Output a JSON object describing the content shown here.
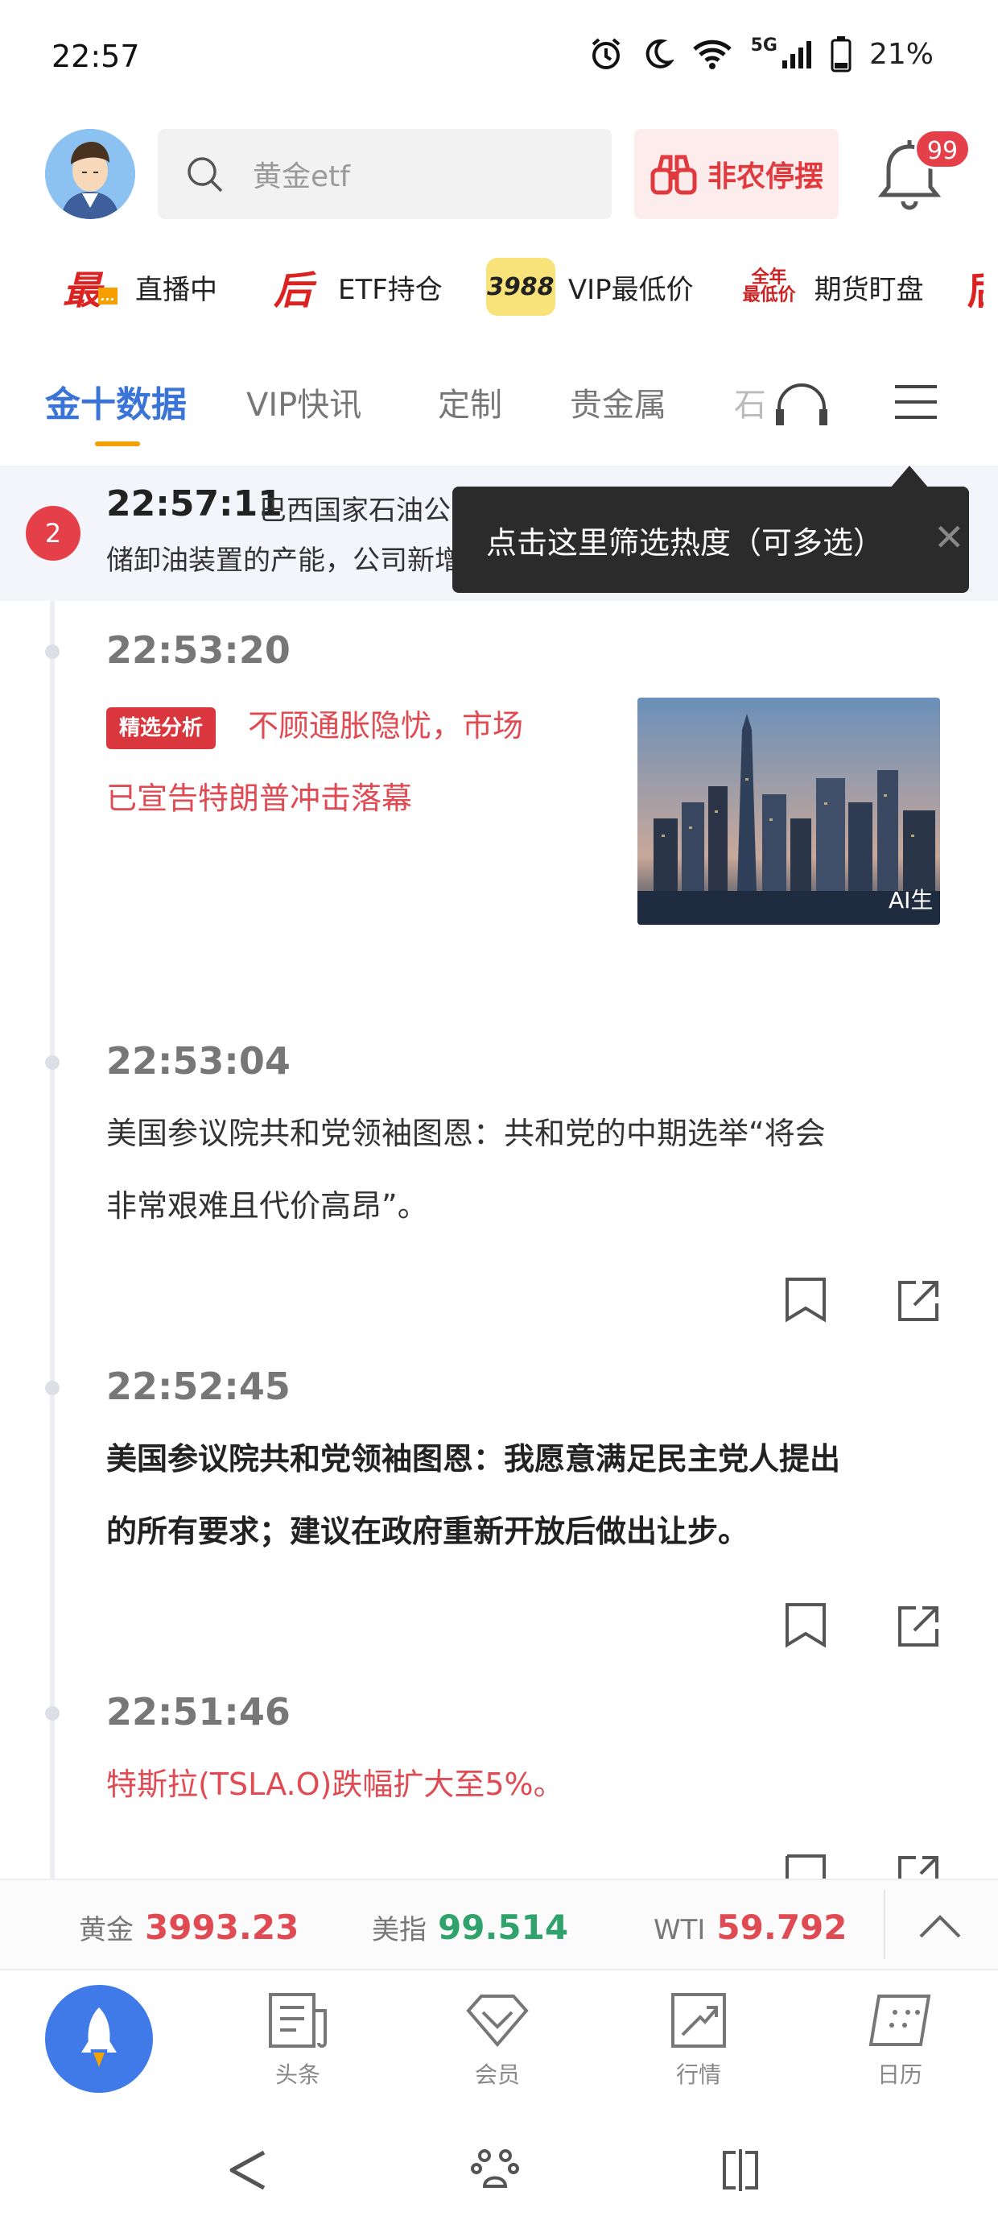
{
  "status_bar": {
    "time": "22:57",
    "network": "5G",
    "battery": "21%"
  },
  "header": {
    "search_placeholder": "黄金etf",
    "promo_label": "非农停摆",
    "notification_count": "99"
  },
  "quick_links": [
    {
      "label": "直播中",
      "icon": "live-icon"
    },
    {
      "label": "ETF持仓",
      "icon": "etf-icon"
    },
    {
      "label": "VIP最低价",
      "icon": "vip-price-icon",
      "badge": "3988"
    },
    {
      "label": "期货盯盘",
      "icon": "futures-icon"
    }
  ],
  "tabs": [
    {
      "label": "金十数据",
      "active": true
    },
    {
      "label": "VIP快讯"
    },
    {
      "label": "定制"
    },
    {
      "label": "贵金属"
    },
    {
      "label": "石"
    }
  ],
  "pinned": {
    "count": "2",
    "time": "22:57:11",
    "line1": "巴西国家石油公司首席财务官：通过提升浮式生产",
    "line2": "储卸油装置的产能，公司新增了11.5万桶/日的产量。"
  },
  "tooltip": {
    "text": "点击这里筛选热度（可多选）"
  },
  "news": [
    {
      "time": "22:53:20",
      "tag": "精选分析",
      "line1": "不顾通胀隐忧，市场",
      "line2": "已宣告特朗普冲击落幕",
      "image_label": "AI生"
    },
    {
      "time": "22:53:04",
      "line1": "美国参议院共和党领袖图恩：共和党的中期选举“将会",
      "line2": "非常艰难且代价高昂”。"
    },
    {
      "time": "22:52:45",
      "line1": "美国参议院共和党领袖图恩：我愿意满足民主党人提出",
      "line2": "的所有要求；建议在政府重新开放后做出让步。"
    },
    {
      "time": "22:51:46",
      "line1": "特斯拉(TSLA.O)跌幅扩大至5%。"
    }
  ],
  "ticker": [
    {
      "name": "黄金",
      "value": "3993.23",
      "color": "#e04a52"
    },
    {
      "name": "美指",
      "value": "99.514",
      "color": "#2fa36b"
    },
    {
      "name": "WTI",
      "value": "59.792",
      "color": "#e04a52"
    }
  ],
  "bottom_nav": [
    {
      "label": "头条"
    },
    {
      "label": "会员"
    },
    {
      "label": "行情"
    },
    {
      "label": "日历"
    }
  ]
}
